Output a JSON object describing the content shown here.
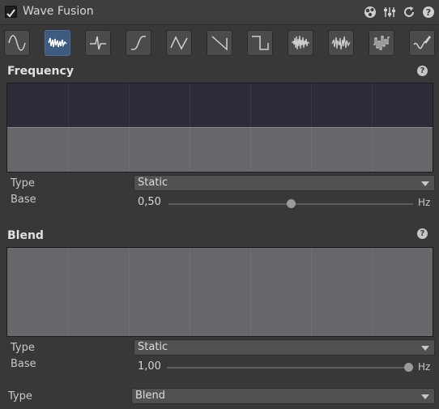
{
  "header": {
    "enabled": true,
    "title": "Wave Fusion",
    "icons": [
      "preset-icon",
      "sliders-icon",
      "reset-icon",
      "help-icon"
    ]
  },
  "wave_buttons": [
    {
      "icon": "sine-wave-icon",
      "active": false
    },
    {
      "icon": "noise-wave-icon",
      "active": true
    },
    {
      "icon": "pulse-wave-icon",
      "active": false
    },
    {
      "icon": "s-curve-wave-icon",
      "active": false
    },
    {
      "icon": "triangle-wave-icon",
      "active": false
    },
    {
      "icon": "sawtooth-wave-icon",
      "active": false
    },
    {
      "icon": "square-wave-icon",
      "active": false
    },
    {
      "icon": "random-noise-icon",
      "active": false
    },
    {
      "icon": "perlin-noise-icon",
      "active": false
    },
    {
      "icon": "stepped-noise-icon",
      "active": false
    },
    {
      "icon": "custom-curve-icon",
      "active": false
    }
  ],
  "frequency": {
    "title": "Frequency",
    "help": "?",
    "graph_level": 0.5,
    "type_label": "Type",
    "type_value": "Static",
    "base_label": "Base",
    "base_value": "0,50",
    "base_fraction": 0.5,
    "unit": "Hz"
  },
  "blend": {
    "title": "Blend",
    "help": "?",
    "graph_level": 1.0,
    "type_label": "Type",
    "type_value": "Static",
    "base_label": "Base",
    "base_value": "1,00",
    "base_fraction": 1.0,
    "unit": "Hz"
  },
  "footer": {
    "type_label": "Type",
    "type_value": "Blend"
  },
  "colors": {
    "accent": "#3d5a7f",
    "graph_fill": "#67676b",
    "graph_bg": "#2d2d39"
  }
}
